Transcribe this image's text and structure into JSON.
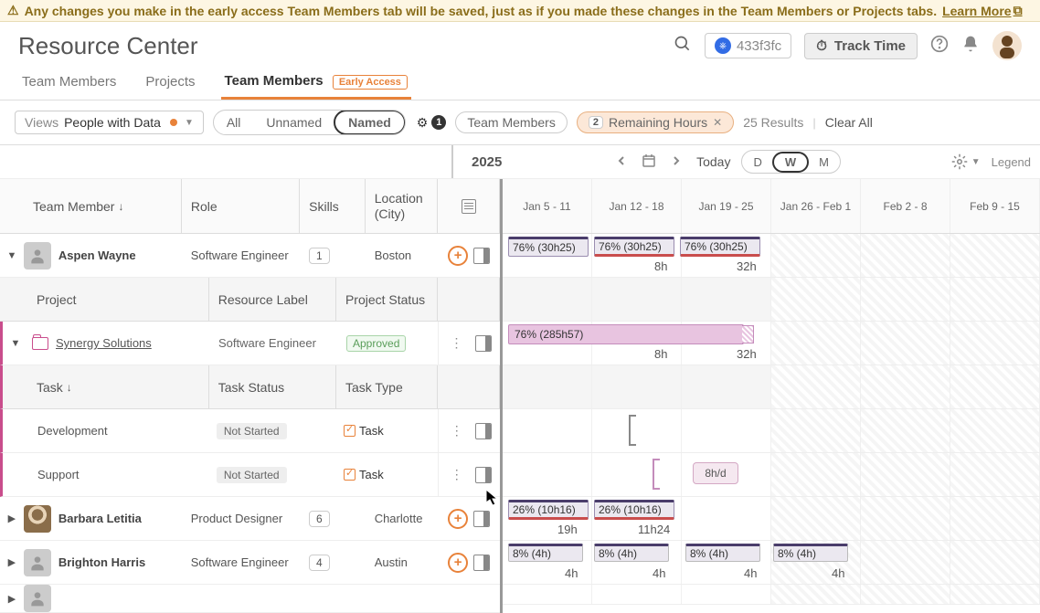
{
  "banner": {
    "text": "Any changes you make in the early access Team Members tab will be saved, just as if you made these changes in the Team Members or Projects tabs.",
    "link": "Learn More"
  },
  "header": {
    "title": "Resource Center",
    "pod": "433f3fc",
    "track_time": "Track Time"
  },
  "tabs": {
    "t1": "Team Members",
    "t2": "Projects",
    "t3": "Team Members",
    "ea": "Early Access"
  },
  "filters": {
    "views_label": "Views",
    "views_value": "People with Data",
    "all": "All",
    "unnamed": "Unnamed",
    "named": "Named",
    "filter_count": "1",
    "chip_tm": "Team Members",
    "chip_rh_count": "2",
    "chip_rh": "Remaining Hours",
    "results": "25 Results",
    "clear": "Clear All"
  },
  "timeline": {
    "year": "2025",
    "today": "Today",
    "d": "D",
    "w": "W",
    "m": "M",
    "legend": "Legend",
    "dates": [
      "Jan 5 - 11",
      "Jan 12 - 18",
      "Jan 19 - 25",
      "Jan 26 - Feb 1",
      "Feb 2 - 8",
      "Feb 9 - 15"
    ]
  },
  "columns": {
    "team_member": "Team Member",
    "role": "Role",
    "skills": "Skills",
    "location": "Location",
    "city": "(City)",
    "project": "Project",
    "resource_label": "Resource Label",
    "project_status": "Project Status",
    "task": "Task",
    "task_status": "Task Status",
    "task_type": "Task Type"
  },
  "members": {
    "aspen": {
      "name": "Aspen Wayne",
      "role": "Software Engineer",
      "skills": "1",
      "location": "Boston"
    },
    "barbara": {
      "name": "Barbara Letitia",
      "role": "Product Designer",
      "skills": "6",
      "location": "Charlotte"
    },
    "brighton": {
      "name": "Brighton Harris",
      "role": "Software Engineer",
      "skills": "4",
      "location": "Austin"
    }
  },
  "project": {
    "name": "Synergy Solutions",
    "label": "Software Engineer",
    "status": "Approved"
  },
  "tasks": {
    "dev": {
      "name": "Development",
      "status": "Not Started",
      "type": "Task"
    },
    "support": {
      "name": "Support",
      "status": "Not Started",
      "type": "Task"
    }
  },
  "bars": {
    "p76": "76% (30h25)",
    "h8": "8h",
    "h32": "32h",
    "p285": "76% (285h57)",
    "hd8": "8h/d",
    "p26": "26% (10h16)",
    "h19": "19h",
    "h1124": "11h24",
    "p8": "8% (4h)",
    "h4": "4h"
  }
}
